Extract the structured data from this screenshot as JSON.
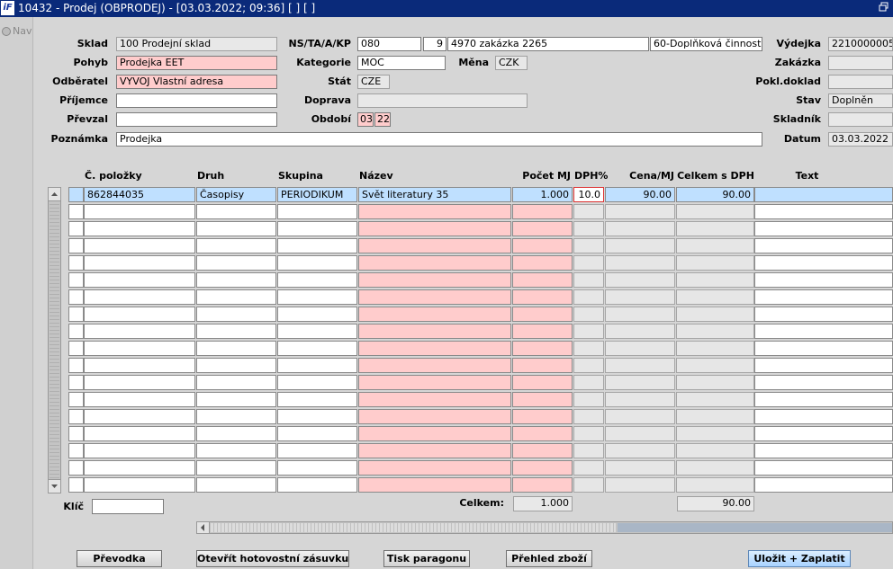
{
  "window": {
    "title": "10432 - Prodej (OBPRODEJ) - [03.03.2022; 09:36]  [ ]  [ ]",
    "app_icon": "iF"
  },
  "nav": {
    "label": "Nav"
  },
  "header": {
    "sklad": {
      "label": "Sklad",
      "value": "100 Prodejní sklad"
    },
    "pohyb": {
      "label": "Pohyb",
      "value": "Prodejka EET"
    },
    "odberatel": {
      "label": "Odběratel",
      "value": "VYVOJ Vlastní adresa"
    },
    "prijemce": {
      "label": "Příjemce",
      "value": ""
    },
    "prevzal": {
      "label": "Převzal",
      "value": ""
    },
    "poznamka": {
      "label": "Poznámka",
      "value": "Prodejka"
    },
    "ns": {
      "label": "NS/TA/A/KP",
      "ns": "080",
      "ta": "9",
      "a": "4970 zakázka 2265",
      "kp": "60-Doplňková činnost"
    },
    "kategorie": {
      "label": "Kategorie",
      "value": "MOC"
    },
    "mena": {
      "label": "Měna",
      "value": "CZK"
    },
    "stat": {
      "label": "Stát",
      "value": "CZE"
    },
    "doprava": {
      "label": "Doprava",
      "value": ""
    },
    "obdobi": {
      "label": "Období",
      "month": "03",
      "year": "22"
    },
    "vydejka": {
      "label": "Výdejka",
      "value": "2210000005"
    },
    "zakazka": {
      "label": "Zakázka",
      "value": ""
    },
    "pokl_doklad": {
      "label": "Pokl.doklad",
      "value": ""
    },
    "stav": {
      "label": "Stav",
      "value": "Doplněn"
    },
    "skladnik": {
      "label": "Skladník",
      "value": ""
    },
    "datum": {
      "label": "Datum",
      "value": "03.03.2022"
    }
  },
  "grid": {
    "columns": [
      "Č. položky",
      "Druh",
      "Skupina",
      "Název",
      "Počet MJ",
      "DPH%",
      "Cena/MJ",
      "Celkem s DPH",
      "Text"
    ],
    "rows": [
      {
        "cislo": "862844035",
        "druh": "Časopisy",
        "skupina": "PERIODIKUM",
        "nazev": "Svět literatury 35",
        "pocet": "1.000",
        "dph": "10.0",
        "cena": "90.00",
        "celkem": "90.00",
        "text": ""
      }
    ],
    "empty_rows": 17
  },
  "footer": {
    "klic_label": "Klíč",
    "klic_value": "",
    "celkem_label": "Celkem:",
    "celkem_pocet": "1.000",
    "celkem_castka": "90.00"
  },
  "buttons": {
    "prevodka": "Převodka",
    "otevrit": "Otevřít hotovostní zásuvku",
    "tisk": "Tisk paragonu",
    "prehled": "Přehled zboží",
    "ulozit": "Uložit + Zaplatit"
  },
  "colors": {
    "title_bg": "#0a2a7a",
    "required_field": "#ffcccc",
    "selected_row": "#bfe0ff",
    "window_bg": "#d6d6d6"
  },
  "icons": [
    "app-logo-icon",
    "window-restore-icon",
    "nav-radio-icon",
    "scroll-up-icon",
    "scroll-down-icon",
    "scroll-left-icon",
    "scroll-right-icon"
  ]
}
